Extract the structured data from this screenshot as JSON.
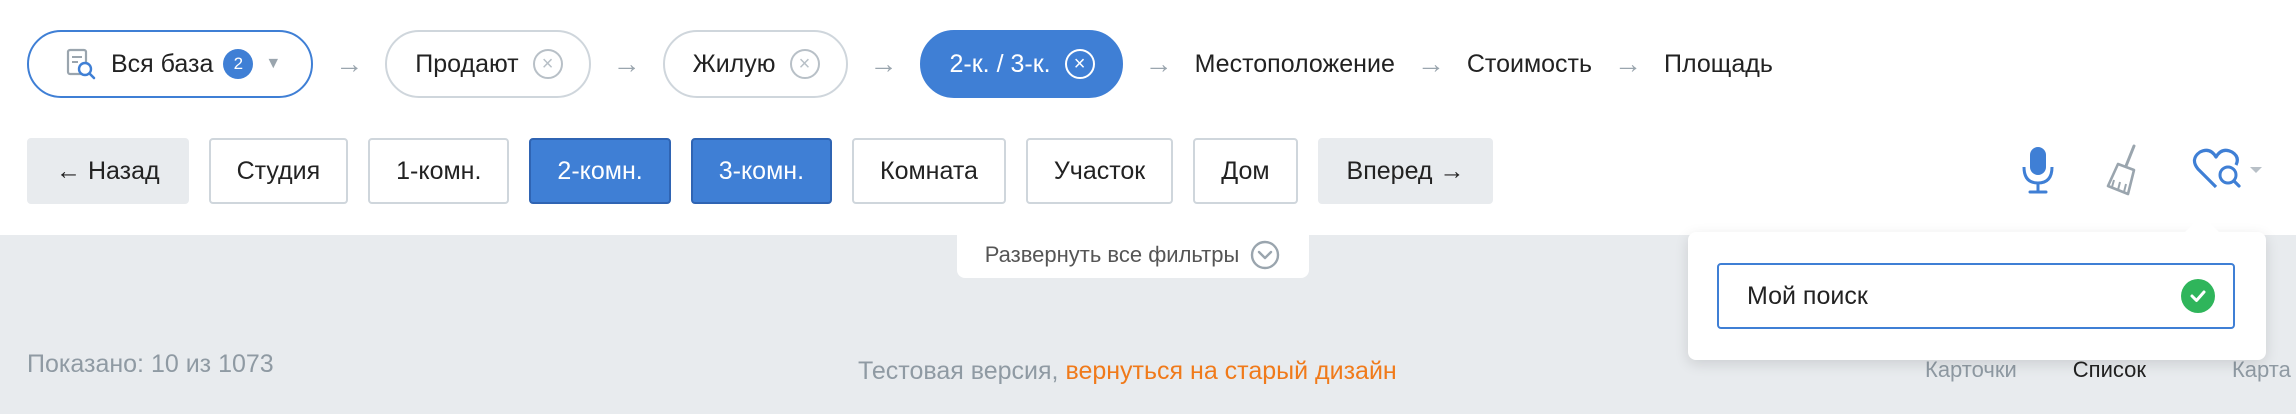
{
  "breadcrumb": {
    "all_base": {
      "label": "Вся база",
      "badge": "2"
    },
    "selling": {
      "label": "Продают"
    },
    "residential": {
      "label": "Жилую"
    },
    "rooms": {
      "label": "2-к. / 3-к."
    },
    "location": "Местоположение",
    "price": "Стоимость",
    "area": "Площадь",
    "arrow": "→"
  },
  "filters": {
    "back": "← Назад",
    "studio": "Студия",
    "one_room": "1-комн.",
    "two_room": "2-комн.",
    "three_room": "3-комн.",
    "room": "Комната",
    "plot": "Участок",
    "house": "Дом",
    "forward": "Вперед →"
  },
  "expand_filters": "Развернуть все фильтры",
  "shown": "Показано: 10 из 1073",
  "test_version": {
    "text": "Тестовая версия, ",
    "link": "вернуться на старый дизайн"
  },
  "views": {
    "cards": "Карточки",
    "list": "Список",
    "map": "Карта"
  },
  "saved_search": {
    "value": "Мой поиск"
  },
  "colors": {
    "accent": "#3f7fd5",
    "link": "#f07a1a",
    "success": "#2fb55b"
  }
}
